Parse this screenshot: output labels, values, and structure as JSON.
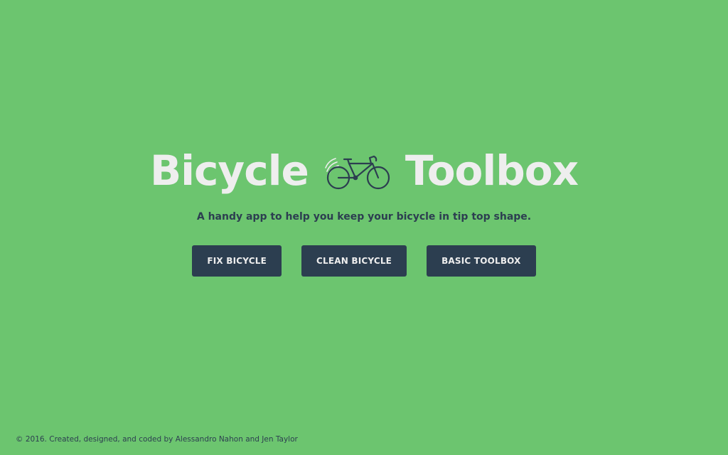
{
  "app": {
    "title_left": "Bicycle",
    "title_right": "Toolbox",
    "logo_icon": "bicycle-icon",
    "subtitle": "A handy app to help you keep your bicycle in tip top shape."
  },
  "buttons": [
    {
      "label": "FIX BICYCLE"
    },
    {
      "label": "CLEAN BICYCLE"
    },
    {
      "label": "BASIC TOOLBOX"
    }
  ],
  "footer": {
    "text": "© 2016. Created, designed, and coded by Alessandro Nahon and Jen Taylor"
  },
  "colors": {
    "background": "#6cc56f",
    "title": "#eeeeee",
    "dark": "#2c3e50",
    "button_text": "#eeeeee"
  }
}
